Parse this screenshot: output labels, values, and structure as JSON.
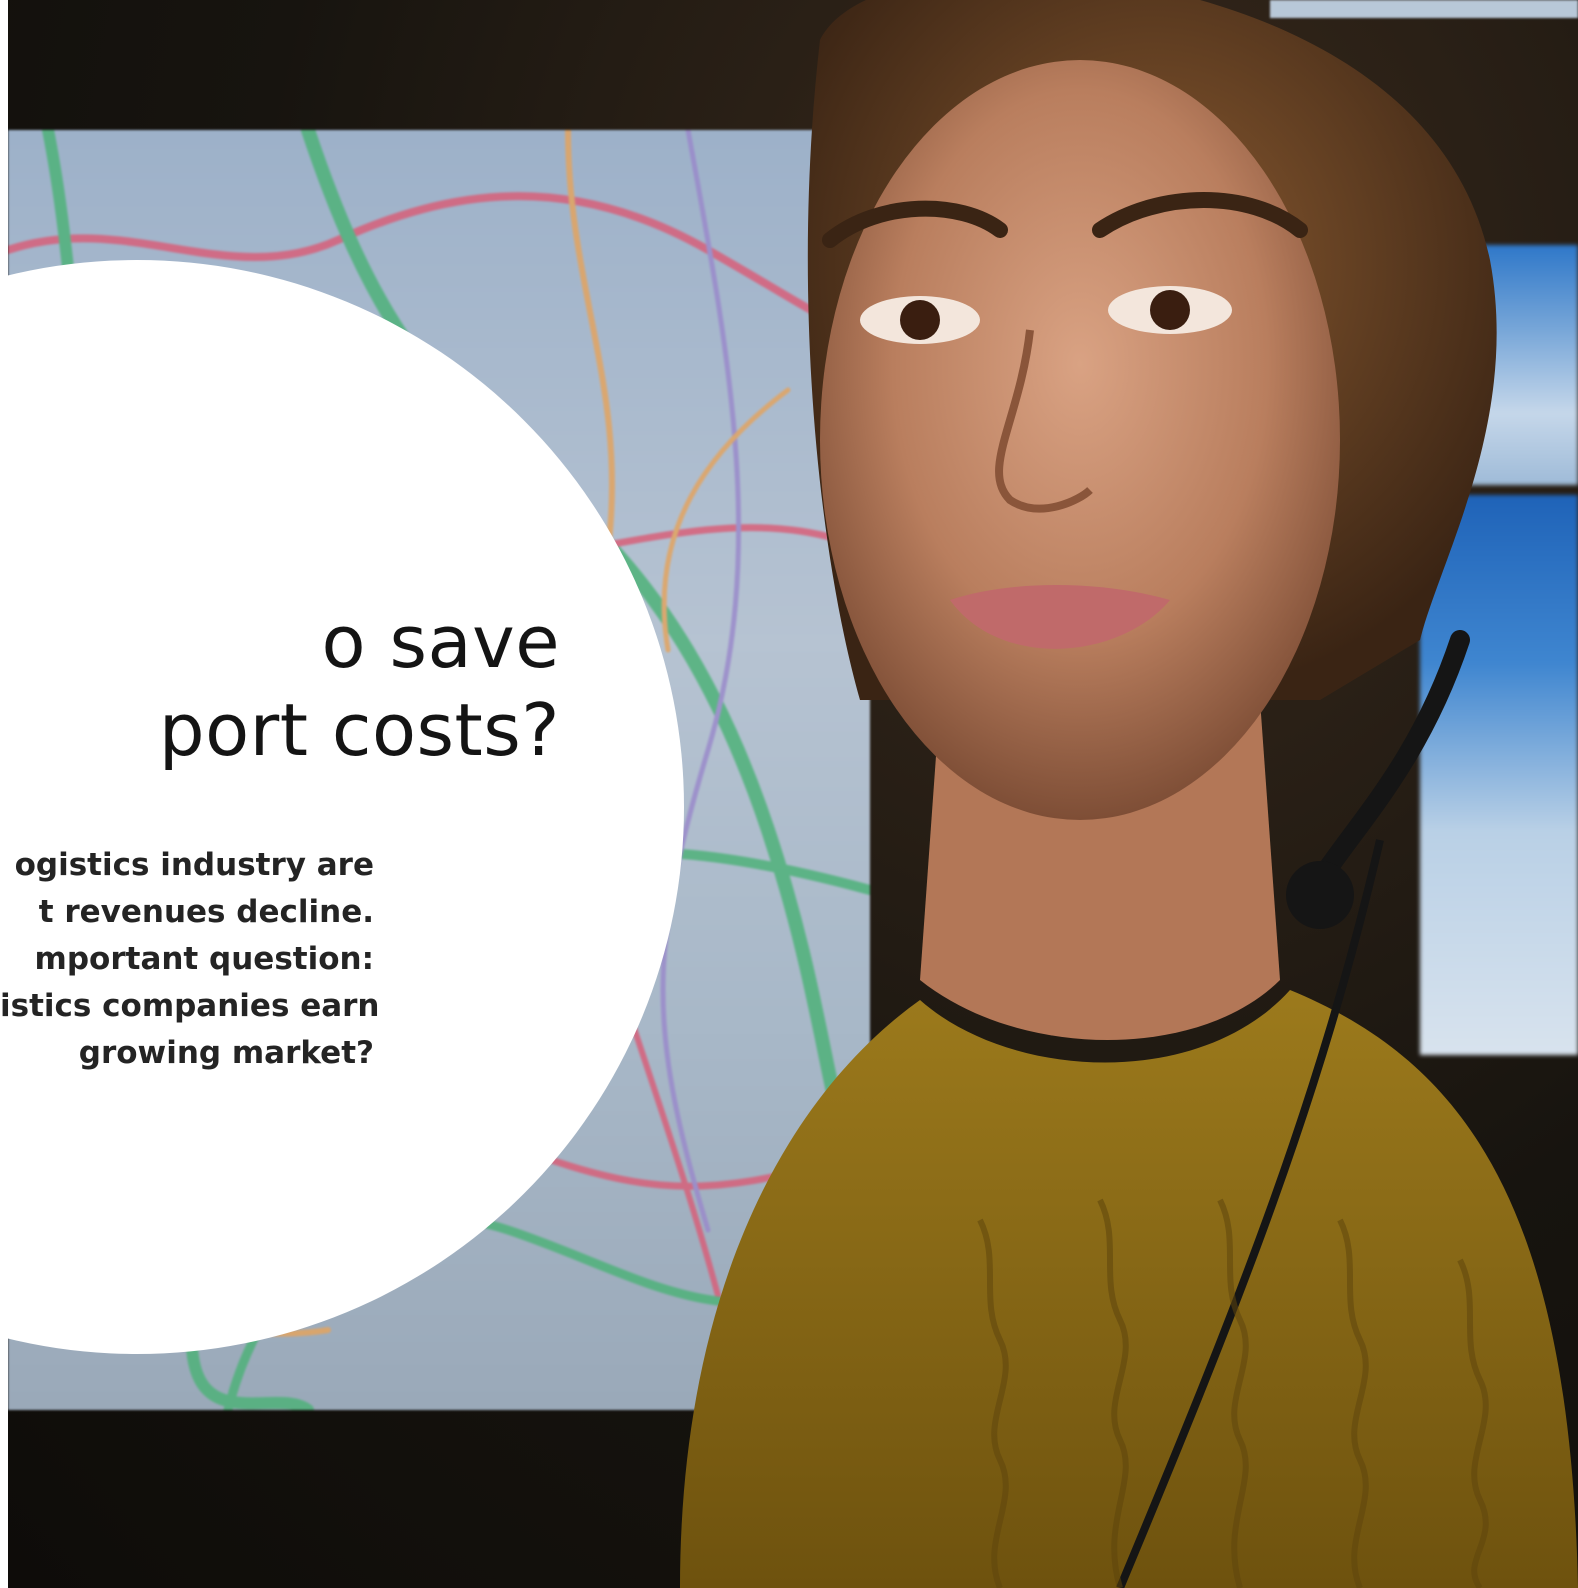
{
  "hero": {
    "headline_lines": [
      "o save",
      "port costs?"
    ],
    "body_lines": [
      "ogistics industry are",
      "t revenues decline.",
      "mportant question:",
      "istics companies earn",
      "growing market?"
    ]
  },
  "image": {
    "subject": "woman-with-headset-icon",
    "background": "map-display-icon"
  },
  "colors": {
    "circle": "#ffffff",
    "headline": "#141414",
    "body": "#242424",
    "sweater": "#8a6a16",
    "skin": "#c08a6a"
  }
}
